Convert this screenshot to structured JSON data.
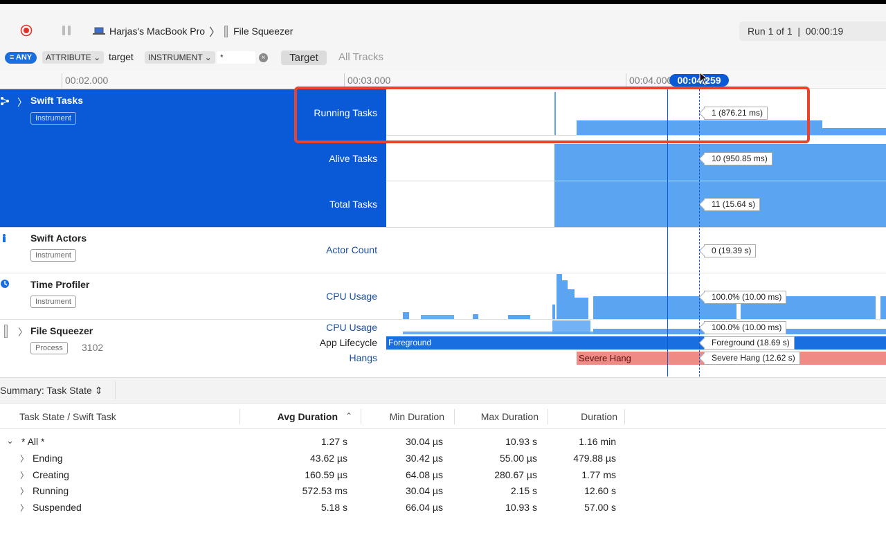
{
  "toolbar": {
    "device": "Harjas's MacBook Pro",
    "process": "File Squeezer",
    "run_status": "Run 1 of 1  |  00:00:19"
  },
  "filter": {
    "any_label": "ANY",
    "attribute_label": "ATTRIBUTE",
    "attribute_value": "target",
    "instrument_label": "INSTRUMENT",
    "instrument_value": "*",
    "target_button": "Target",
    "all_tracks_button": "All Tracks"
  },
  "ruler": {
    "ticks": [
      "00:02.000",
      "00:03.000",
      "00:04.000"
    ],
    "playhead": "00:04.259"
  },
  "tracks": {
    "swift_tasks": {
      "name": "Swift Tasks",
      "badge": "Instrument",
      "running_label": "Running Tasks",
      "running_value": "1 (876.21 ms)",
      "alive_label": "Alive Tasks",
      "alive_value": "10 (950.85 ms)",
      "total_label": "Total Tasks",
      "total_value": "11 (15.64 s)"
    },
    "swift_actors": {
      "name": "Swift Actors",
      "badge": "Instrument",
      "actor_label": "Actor Count",
      "actor_value": "0 (19.39 s)"
    },
    "time_profiler": {
      "name": "Time Profiler",
      "badge": "Instrument",
      "cpu_label": "CPU Usage",
      "cpu_value": "100.0% (10.00 ms)"
    },
    "file_squeezer": {
      "name": "File Squeezer",
      "badge": "Process",
      "pid": "3102",
      "cpu_label": "CPU Usage",
      "cpu_value": "100.0% (10.00 ms)",
      "lifecycle_label": "App Lifecycle",
      "lifecycle_bar": "Foreground",
      "lifecycle_value": "Foreground (18.69 s)",
      "hangs_label": "Hangs",
      "hang_bar": "Severe Hang",
      "hang_value": "Severe Hang (12.62 s)"
    }
  },
  "summary": {
    "title": "Summary: Task State",
    "columns": [
      "Task State / Swift Task",
      "Avg Duration",
      "Min Duration",
      "Max Duration",
      "Duration"
    ],
    "rows": [
      {
        "label": "* All *",
        "avg": "1.27 s",
        "min": "30.04 µs",
        "max": "10.93 s",
        "dur": "1.16 min"
      },
      {
        "label": "Ending",
        "avg": "43.62 µs",
        "min": "30.42 µs",
        "max": "55.00 µs",
        "dur": "479.88 µs"
      },
      {
        "label": "Creating",
        "avg": "160.59 µs",
        "min": "64.08 µs",
        "max": "280.67 µs",
        "dur": "1.77 ms"
      },
      {
        "label": "Running",
        "avg": "572.53 ms",
        "min": "30.04 µs",
        "max": "2.15 s",
        "dur": "12.60 s"
      },
      {
        "label": "Suspended",
        "avg": "5.18 s",
        "min": "66.04 µs",
        "max": "10.93 s",
        "dur": "57.00 s"
      }
    ]
  },
  "colors": {
    "selection": "#0a5ad8",
    "graph": "#5aa4f2",
    "hang": "#f08a84",
    "highlight": "#e8432f"
  }
}
